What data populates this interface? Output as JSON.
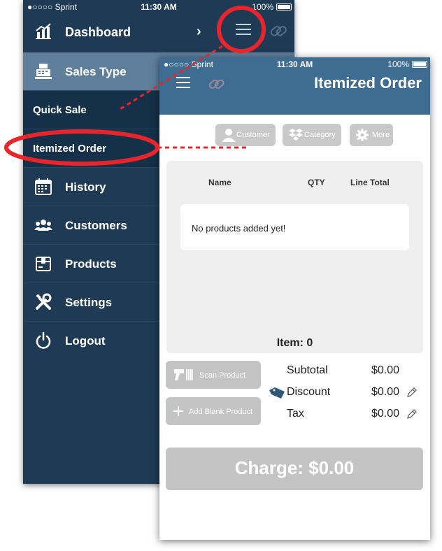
{
  "status_bar": {
    "carrier": "●○○○○ Sprint",
    "time": "11:30 AM",
    "battery": "100%"
  },
  "menu": {
    "dashboard_label": "Dashboard",
    "sales_type_label": "Sales Type",
    "sub_items": [
      "Quick Sale",
      "Itemized Order"
    ],
    "items": [
      {
        "label": "History",
        "icon": "calendar-icon"
      },
      {
        "label": "Customers",
        "icon": "people-icon"
      },
      {
        "label": "Products",
        "icon": "box-icon"
      },
      {
        "label": "Settings",
        "icon": "tools-icon"
      },
      {
        "label": "Logout",
        "icon": "power-icon"
      }
    ]
  },
  "order": {
    "title": "Itemized Order",
    "buttons": {
      "customer": "Customer",
      "category": "Category",
      "more": "More"
    },
    "columns": [
      "Name",
      "QTY",
      "Line Total"
    ],
    "empty_message": "No products added yet!",
    "item_count": "Item: 0",
    "scan_product": "Scan Product",
    "add_blank_product": "Add Blank Product",
    "subtotal_label": "Subtotal",
    "subtotal_value": "$0.00",
    "discount_label": "Discount",
    "discount_value": "$0.00",
    "tax_label": "Tax",
    "tax_value": "$0.00",
    "charge_label": "Charge: $0.00"
  },
  "colors": {
    "menu_bg": "#1e3a55",
    "menu_selected": "#5f7e9a",
    "header_blue": "#3f6d91",
    "annotation_red": "#e8252b",
    "button_gray": "#c4c4c4"
  }
}
